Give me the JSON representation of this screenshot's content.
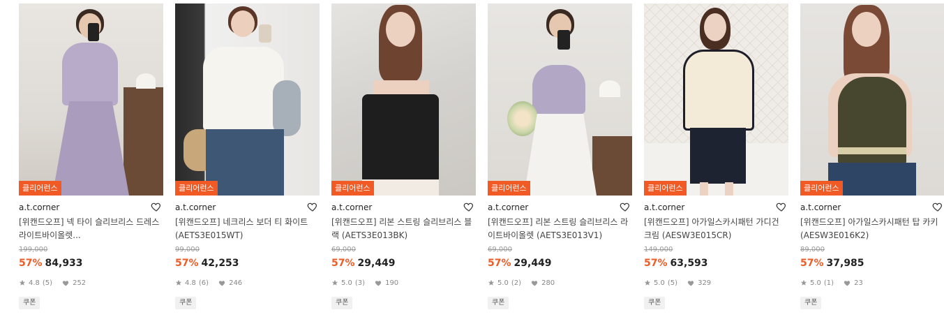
{
  "badge_label": "클리어런스",
  "coupon_label": "쿠폰",
  "colors": {
    "accent": "#f15a24",
    "badge_bg": "#f15a24"
  },
  "products": [
    {
      "brand": "a.t.corner",
      "title": "[위캔드오프] 넥 타이 슬리브리스 드레스 라이트바이올렛...",
      "original_price": "199,000",
      "discount": "57%",
      "price": "84,933",
      "rating": "4.8",
      "reviews": "(5)",
      "likes": "252"
    },
    {
      "brand": "a.t.corner",
      "title": "[위캔드오프] 네크리스 보더 티 화이트 (AETS3E015WT)",
      "original_price": "99,000",
      "discount": "57%",
      "price": "42,253",
      "rating": "4.8",
      "reviews": "(6)",
      "likes": "246"
    },
    {
      "brand": "a.t.corner",
      "title": "[위캔드오프] 리본 스트링 슬리브리스 블랙 (AETS3E013BK)",
      "original_price": "69,000",
      "discount": "57%",
      "price": "29,449",
      "rating": "5.0",
      "reviews": "(3)",
      "likes": "190"
    },
    {
      "brand": "a.t.corner",
      "title": "[위캔드오프] 리본 스트링 슬리브리스 라이트바이올렛 (AETS3E013V1)",
      "original_price": "69,000",
      "discount": "57%",
      "price": "29,449",
      "rating": "5.0",
      "reviews": "(2)",
      "likes": "280"
    },
    {
      "brand": "a.t.corner",
      "title": "[위캔드오프] 아가일스카시패턴 가디건 크림 (AESW3E015CR)",
      "original_price": "149,000",
      "discount": "57%",
      "price": "63,593",
      "rating": "5.0",
      "reviews": "(5)",
      "likes": "329"
    },
    {
      "brand": "a.t.corner",
      "title": "[위캔드오프] 아가일스카시패턴 탑 카키 (AESW3E016K2)",
      "original_price": "89,000",
      "discount": "57%",
      "price": "37,985",
      "rating": "5.0",
      "reviews": "(1)",
      "likes": "23"
    }
  ]
}
